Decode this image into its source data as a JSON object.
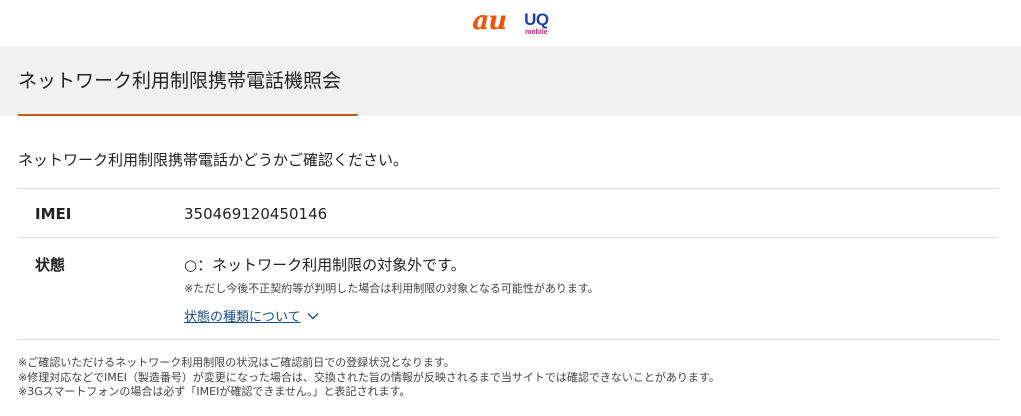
{
  "header": {
    "logo_au": "au",
    "logo_uq": "UQ",
    "logo_uq_sub": "mobile"
  },
  "page": {
    "title": "ネットワーク利用制限携帯電話機照会",
    "intro": "ネットワーク利用制限携帯電話かどうかご確認ください。"
  },
  "result": {
    "imei_label": "IMEI",
    "imei_value": "350469120450146",
    "status_label": "状態",
    "status_value": "○：ネットワーク利用制限の対象外です。",
    "status_note": "※ただし今後不正契約等が判明した場合は利用制限の対象となる可能性があります。",
    "status_link": "状態の種類について"
  },
  "footnotes": [
    "※ご確認いただけるネットワーク利用制限の状況はご確認前日での登録状況となります。",
    "※修理対応などでIMEI（製造番号）が変更になった場合は、交換された旨の情報が反映されるまで当サイトでは確認できないことがあります。",
    "※3Gスマートフォンの場合は必ず「IMEIが確認できません。」と表記されます。"
  ],
  "colors": {
    "accent": "#c8590e",
    "au_brand": "#eb5505",
    "uq_brand": "#1d3f9d",
    "link": "#1a4e8a"
  },
  "icons": {
    "link_chevron": "chevron-down-icon"
  }
}
